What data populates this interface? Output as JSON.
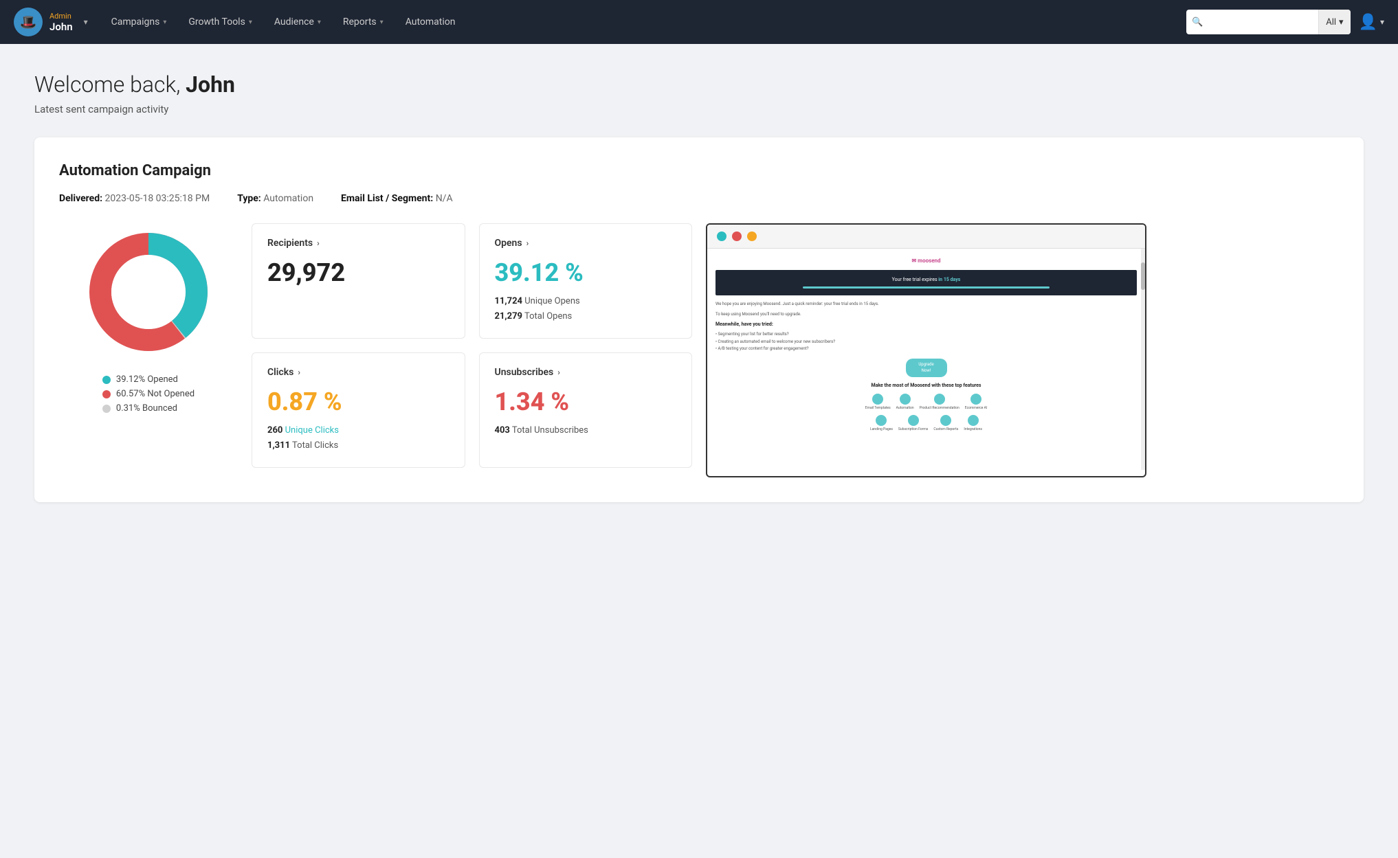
{
  "nav": {
    "user_role": "Admin",
    "user_name": "John",
    "items": [
      {
        "label": "Campaigns",
        "has_dropdown": true
      },
      {
        "label": "Growth Tools",
        "has_dropdown": true
      },
      {
        "label": "Audience",
        "has_dropdown": true
      },
      {
        "label": "Reports",
        "has_dropdown": true
      },
      {
        "label": "Automation",
        "has_dropdown": false
      }
    ],
    "search_placeholder": "",
    "search_filter": "All"
  },
  "page": {
    "welcome_prefix": "Welcome back, ",
    "welcome_name": "John",
    "subtitle": "Latest sent campaign activity"
  },
  "campaign": {
    "title": "Automation Campaign",
    "delivered_label": "Delivered:",
    "delivered_value": "2023-05-18 03:25:18 PM",
    "type_label": "Type:",
    "type_value": "Automation",
    "segment_label": "Email List / Segment:",
    "segment_value": "N/A"
  },
  "stats": {
    "recipients": {
      "label": "Recipients",
      "value": "29,972"
    },
    "opens": {
      "label": "Opens",
      "percent": "39.12 %",
      "unique_label": "Unique Opens",
      "unique_value": "11,724",
      "total_label": "Total Opens",
      "total_value": "21,279"
    },
    "clicks": {
      "label": "Clicks",
      "percent": "0.87 %",
      "unique_label": "Unique Clicks",
      "unique_value": "260",
      "total_label": "Total Clicks",
      "total_value": "1,311"
    },
    "unsubscribes": {
      "label": "Unsubscribes",
      "percent": "1.34 %",
      "total_label": "Total Unsubscribes",
      "total_value": "403"
    }
  },
  "donut": {
    "opened_pct": "39.12%",
    "opened_label": "Opened",
    "not_opened_pct": "60.57%",
    "not_opened_label": "Not Opened",
    "bounced_pct": "0.31%",
    "bounced_label": "Bounced",
    "colors": {
      "opened": "#2bbcc0",
      "not_opened": "#e05252",
      "bounced": "#d0d0d0"
    }
  },
  "email_preview": {
    "dot1_color": "#2bbcc0",
    "dot2_color": "#e05252",
    "dot3_color": "#f5a623",
    "banner_text_prefix": "Your free trial expires ",
    "banner_text_bold": "in 15 days",
    "body_text1": "We hope you are enjoying Moosend. Just a quick reminder: your free trial ends in 15 days.",
    "body_text2": "To keep using Moosend you'll need to upgrade.",
    "heading": "Meanwhile, have you tried:",
    "list_items": [
      "• Segmenting your list for better results?",
      "• Creating an automated email to welcome your new subscribers?",
      "• A/B testing your content for greater engagement?"
    ],
    "btn_label": "Upgrade Now!",
    "features_title": "Make the most of Moosend with these top features",
    "icons_row1": [
      "Email Templates",
      "Automation",
      "Product Recommendation",
      "Ecommerce AI"
    ],
    "icons_row2": [
      "Landing Pages",
      "Subscription Forms",
      "Custom Reports",
      "Integrations"
    ]
  }
}
